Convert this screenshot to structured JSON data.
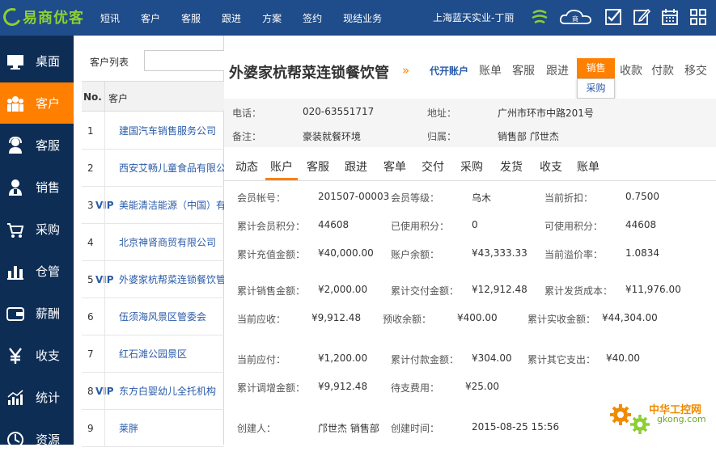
{
  "app": {
    "logo_text": "易商优客",
    "company": "上海蓝天实业-丁丽"
  },
  "topnav": [
    "短讯",
    "客户",
    "客服",
    "跟进",
    "方案",
    "签约",
    "现结业务"
  ],
  "sidebar": [
    {
      "label": "桌面",
      "icon": "desktop-icon"
    },
    {
      "label": "客户",
      "icon": "customers-icon",
      "active": true
    },
    {
      "label": "客服",
      "icon": "service-icon"
    },
    {
      "label": "销售",
      "icon": "sales-icon"
    },
    {
      "label": "采购",
      "icon": "cart-icon"
    },
    {
      "label": "仓管",
      "icon": "warehouse-icon"
    },
    {
      "label": "薪酬",
      "icon": "wallet-icon"
    },
    {
      "label": "收支",
      "icon": "yen-icon"
    },
    {
      "label": "统计",
      "icon": "chart-icon"
    },
    {
      "label": "资源",
      "icon": "resource-icon"
    }
  ],
  "customer_list": {
    "title": "客户列表",
    "search_placeholder": "",
    "col_no": "No.",
    "col_customer": "客户",
    "rows": [
      {
        "no": "1",
        "vip": "",
        "name": "建国汽车销售服务公司"
      },
      {
        "no": "2",
        "vip": "",
        "name": "西安艾畅儿童食品有限公司"
      },
      {
        "no": "3",
        "vip": "VIP",
        "name": "美能清洁能源（中国）有限公司"
      },
      {
        "no": "4",
        "vip": "",
        "name": "北京神肾商贸有限公司"
      },
      {
        "no": "5",
        "vip": "VIP",
        "name": "外婆家杭帮菜连锁餐饮管理"
      },
      {
        "no": "6",
        "vip": "",
        "name": "伍须海风景区管委会"
      },
      {
        "no": "7",
        "vip": "",
        "name": "红石滩公园景区"
      },
      {
        "no": "8",
        "vip": "VIP",
        "name": "东方白婴幼儿全托机构"
      },
      {
        "no": "9",
        "vip": "",
        "name": "莱胖"
      }
    ]
  },
  "detail": {
    "title": "外婆家杭帮菜连锁餐饮管",
    "arrows": "»",
    "agent_link": "代开账户",
    "top_tabs": [
      "账单",
      "客服",
      "跟进",
      "销售",
      "收款",
      "付款",
      "移交"
    ],
    "sales_dropdown": "采购",
    "info": {
      "phone_label": "电话：",
      "phone": "020-63551717",
      "address_label": "地址：",
      "address": "广州市环市中路201号",
      "note_label": "备注：",
      "note": "豪装就餐环境",
      "owner_label": "归属：",
      "owner": "销售部 邝世杰"
    },
    "sub_tabs": [
      "动态",
      "账户",
      "客服",
      "跟进",
      "客单",
      "交付",
      "采购",
      "发货",
      "收支",
      "账单"
    ],
    "active_sub_tab": "账户",
    "fields": [
      {
        "label": "会员帐号：",
        "value": "201507-00003"
      },
      {
        "label": "会员等级：",
        "value": "乌木"
      },
      {
        "label": "当前折扣：",
        "value": "0.7500"
      },
      {
        "label": "累计会员积分：",
        "value": "44608"
      },
      {
        "label": "已使用积分：",
        "value": "0"
      },
      {
        "label": "可使用积分：",
        "value": "44608"
      },
      {
        "label": "累计充值金额：",
        "value": "¥40,000.00"
      },
      {
        "label": "账户余额：",
        "value": "¥43,333.33"
      },
      {
        "label": "当前溢价率：",
        "value": "1.0834"
      },
      {
        "label": "累计销售金额：",
        "value": "¥2,000.00"
      },
      {
        "label": "累计交付金额：",
        "value": "¥12,912.48"
      },
      {
        "label": "累计发货成本：",
        "value": "¥11,976.00"
      },
      {
        "label": "当前应收：",
        "value": "¥9,912.48"
      },
      {
        "label": "预收余额：",
        "value": "¥400.00"
      },
      {
        "label": "累计实收金额：",
        "value": "¥44,304.00"
      },
      {
        "label": "当前应付：",
        "value": "¥1,200.00"
      },
      {
        "label": "累计付款金额：",
        "value": "¥304.00"
      },
      {
        "label": "累计其它支出：",
        "value": "¥40.00"
      },
      {
        "label": "累计调增金额：",
        "value": "¥9,912.48"
      },
      {
        "label": "待支费用：",
        "value": "¥25.00"
      },
      {
        "label": "创建人：",
        "value": "邝世杰 销售部"
      },
      {
        "label": "创建时间：",
        "value": "2015-08-25 15:56"
      }
    ]
  },
  "watermark": {
    "text": "中华工控网",
    "url": "gkong.com"
  },
  "colors": {
    "topbar": "#1f4c8a",
    "sidebar": "#0d2d55",
    "accent": "#ff7f00",
    "link": "#2a5ba8",
    "logo": "#8ccf33"
  }
}
